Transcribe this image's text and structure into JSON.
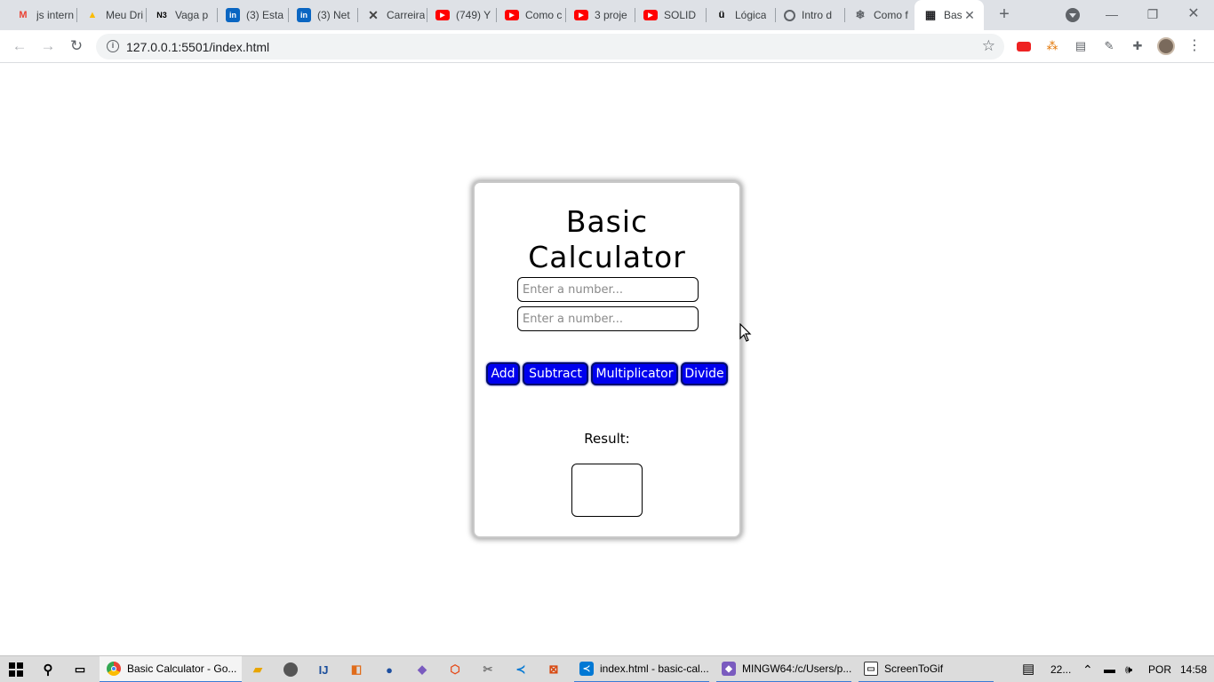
{
  "browser": {
    "tabs": [
      {
        "title": "js intern",
        "icon": "gmail-icon",
        "color": "#ea4335",
        "glyph": "M"
      },
      {
        "title": "Meu Dri",
        "icon": "google-drive-icon",
        "color": "#fbbc04",
        "glyph": "▲"
      },
      {
        "title": "Vaga p",
        "icon": "n3-icon",
        "color": "#000000",
        "glyph": "N3"
      },
      {
        "title": "(3) Esta",
        "icon": "linkedin-icon",
        "color": "#0a66c2",
        "glyph": "in"
      },
      {
        "title": "(3) Net",
        "icon": "linkedin-icon",
        "color": "#0a66c2",
        "glyph": "in"
      },
      {
        "title": "Carreira",
        "icon": "x-logo-icon",
        "color": "#444444",
        "glyph": "✕"
      },
      {
        "title": "(749) Y",
        "icon": "youtube-icon",
        "color": "#ff0000",
        "glyph": "▶"
      },
      {
        "title": "Como c",
        "icon": "youtube-icon",
        "color": "#ff0000",
        "glyph": "▶"
      },
      {
        "title": "3 proje",
        "icon": "youtube-icon",
        "color": "#ff0000",
        "glyph": "▶"
      },
      {
        "title": "SOLID",
        "icon": "youtube-icon",
        "color": "#ff0000",
        "glyph": "▶"
      },
      {
        "title": "Lógica",
        "icon": "udemy-icon",
        "color": "#000000",
        "glyph": "ü"
      },
      {
        "title": "Intro d",
        "icon": "globe-icon",
        "color": "#5f6368",
        "glyph": "🌐"
      },
      {
        "title": "Como f",
        "icon": "snowflake-icon",
        "color": "#5f6368",
        "glyph": "❄"
      },
      {
        "title": "Bas",
        "icon": "calculator-icon",
        "color": "#202124",
        "glyph": "▦",
        "active": true
      }
    ],
    "new_tab_label": "+",
    "url": "127.0.0.1:5501/index.html"
  },
  "calculator": {
    "title_line1": "Basic",
    "title_line2": "Calculator",
    "input1_placeholder": "Enter a number...",
    "input2_placeholder": "Enter a number...",
    "buttons": {
      "add": "Add",
      "subtract": "Subtract",
      "multiply": "Multiplicator",
      "divide": "Divide"
    },
    "result_label": "Result:",
    "result_value": "",
    "button_color": "#0000ee"
  },
  "taskbar": {
    "apps": [
      {
        "label": "Basic Calculator - Go...",
        "icon": "chrome-icon"
      },
      {
        "label": "index.html - basic-cal...",
        "icon": "vscode-icon"
      },
      {
        "label": "MINGW64:/c/Users/p...",
        "icon": "git-bash-icon"
      },
      {
        "label": "ScreenToGif",
        "icon": "screentogif-icon"
      }
    ],
    "tray": {
      "weather": "22...",
      "language": "POR",
      "time": "14:58"
    }
  }
}
